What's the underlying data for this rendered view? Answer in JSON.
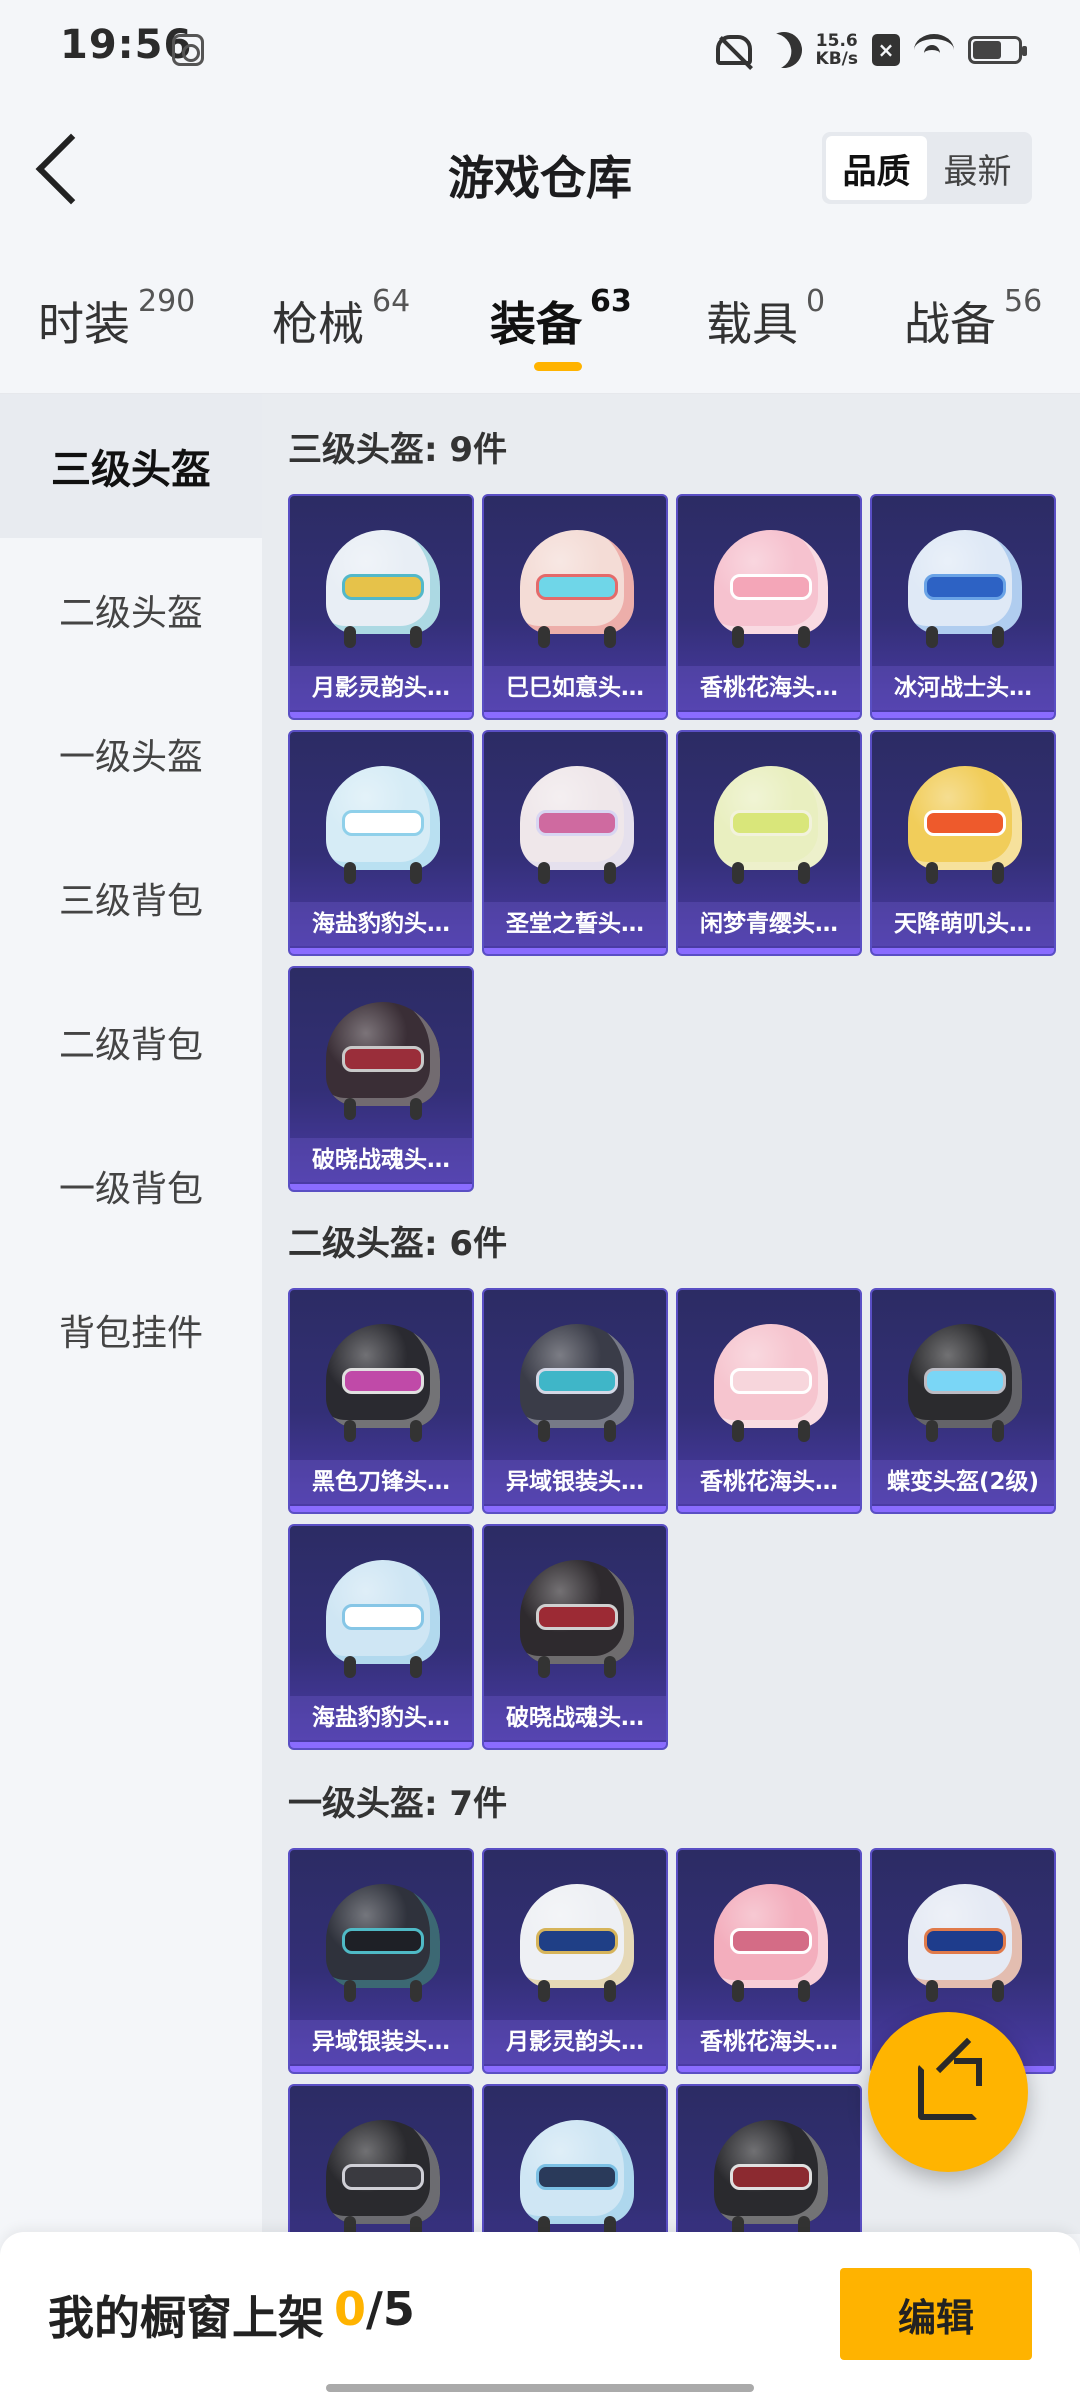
{
  "status_bar": {
    "time": "19:56",
    "net_speed_value": "15.6",
    "net_speed_unit": "KB/s"
  },
  "header": {
    "title": "游戏仓库",
    "sort_options": [
      "品质",
      "最新"
    ],
    "sort_active": "品质"
  },
  "tabs": [
    {
      "label": "时装",
      "count": "290"
    },
    {
      "label": "枪械",
      "count": "64"
    },
    {
      "label": "装备",
      "count": "63",
      "active": true
    },
    {
      "label": "载具",
      "count": "0"
    },
    {
      "label": "战备",
      "count": "56"
    }
  ],
  "sidebar": {
    "items": [
      "三级头盔",
      "二级头盔",
      "一级头盔",
      "三级背包",
      "二级背包",
      "一级背包",
      "背包挂件"
    ],
    "active": "三级头盔"
  },
  "sections": [
    {
      "title": "三级头盔: 9件",
      "items": [
        {
          "name": "月影灵韵头…",
          "shell": "#e8eef5",
          "visor": "#e6c24a",
          "accent": "#52b8c9"
        },
        {
          "name": "巳巳如意头…",
          "shell": "#f4dcd6",
          "visor": "#6fd6e8",
          "accent": "#e46a6a"
        },
        {
          "name": "香桃花海头…",
          "shell": "#f6c2cf",
          "visor": "#f4a6b8",
          "accent": "#ffffff"
        },
        {
          "name": "冰河战士头…",
          "shell": "#dfe9f6",
          "visor": "#2d62c4",
          "accent": "#6aa3e6"
        },
        {
          "name": "海盐豹豹头…",
          "shell": "#d6ecf6",
          "visor": "#ffffff",
          "accent": "#8fd0ea"
        },
        {
          "name": "圣堂之誓头…",
          "shell": "#efe7ea",
          "visor": "#cf6aa0",
          "accent": "#d8d6f2"
        },
        {
          "name": "闲梦青缨头…",
          "shell": "#e9efc0",
          "visor": "#d9e67a",
          "accent": "#f2f2dc"
        },
        {
          "name": "天降萌叽头…",
          "shell": "#f1cd5a",
          "visor": "#ee5a2c",
          "accent": "#ffffff"
        },
        {
          "name": "破晓战魂头…",
          "shell": "#3a2e36",
          "visor": "#9a2e3a",
          "accent": "#c9c9c9"
        }
      ]
    },
    {
      "title": "二级头盔: 6件",
      "items": [
        {
          "name": "黑色刀锋头…",
          "shell": "#2a2a30",
          "visor": "#c04aa8",
          "accent": "#e0e0e0"
        },
        {
          "name": "异域银装头…",
          "shell": "#3a3c48",
          "visor": "#3fb6c8",
          "accent": "#d4d8e6"
        },
        {
          "name": "香桃花海头…",
          "shell": "#f6c5cf",
          "visor": "#f7d6dc",
          "accent": "#ffffff"
        },
        {
          "name": "蝶变头盔(2级)",
          "shell": "#2b2b2e",
          "visor": "#7ad6f6",
          "accent": "#bcbcc4"
        },
        {
          "name": "海盐豹豹头…",
          "shell": "#cfe6f4",
          "visor": "#ffffff",
          "accent": "#86c6e6"
        },
        {
          "name": "破晓战魂头…",
          "shell": "#2e2a2e",
          "visor": "#9c2a34",
          "accent": "#d0d0d0"
        }
      ]
    },
    {
      "title": "一级头盔: 7件",
      "items": [
        {
          "name": "异域银装头…",
          "shell": "#2f323c",
          "visor": "#1e2026",
          "accent": "#4fbac6"
        },
        {
          "name": "月影灵韵头…",
          "shell": "#eef0f4",
          "visor": "#1f3f86",
          "accent": "#d6b45a"
        },
        {
          "name": "香桃花海头…",
          "shell": "#f3aebd",
          "visor": "#d46c86",
          "accent": "#ffffff"
        },
        {
          "name": "",
          "shell": "#e5eaf4",
          "visor": "#1e3c8c",
          "accent": "#e07a4a"
        },
        {
          "name": "",
          "shell": "#2a2a2e",
          "visor": "#3a3a40",
          "accent": "#cfcfd6"
        },
        {
          "name": "",
          "shell": "#cfe6f4",
          "visor": "#2a3a5a",
          "accent": "#7cc0e4"
        },
        {
          "name": "",
          "shell": "#2a2a2e",
          "visor": "#8c2a30",
          "accent": "#e0e0e0"
        }
      ]
    }
  ],
  "bottom_bar": {
    "label": "我的橱窗上架",
    "count": "0",
    "separator": "/",
    "total": "5",
    "edit_button": "编辑"
  },
  "fab_icon": "share-icon"
}
